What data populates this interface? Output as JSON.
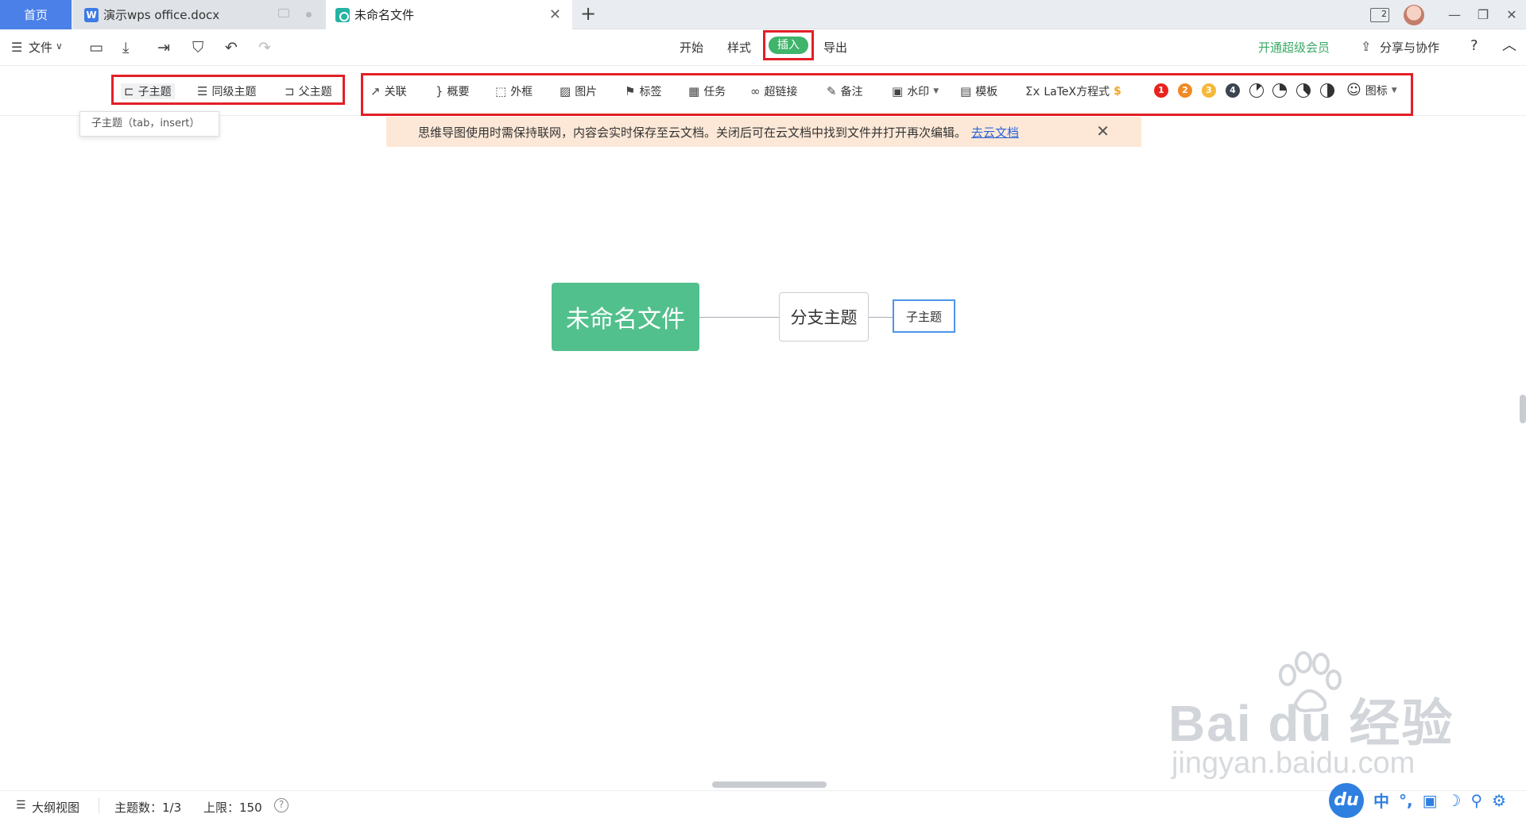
{
  "tabs": {
    "home": "首页",
    "doc": "演示wps office.docx",
    "doc_icon": "W",
    "mind": "未命名文件",
    "add": "+",
    "close": "✕"
  },
  "window": {
    "badge": "2",
    "minimize": "—",
    "restore": "❐",
    "close": "✕"
  },
  "menubar": {
    "file": "文件",
    "tabs": [
      "开始",
      "样式",
      "插入",
      "导出"
    ],
    "active_tab": "插入",
    "vip": "开通超级会员",
    "share": "分享与协作",
    "help": "?",
    "collapse": "︿"
  },
  "toolbar": {
    "group1": [
      "子主题",
      "同级主题",
      "父主题"
    ],
    "group2": [
      "关联",
      "概要",
      "外框",
      "图片",
      "标签",
      "任务",
      "超链接",
      "备注",
      "水印",
      "模板",
      "LaTeX方程式"
    ],
    "priority": [
      "1",
      "2",
      "3",
      "4"
    ],
    "icons_label": "图标",
    "latex_icon": "Σx"
  },
  "tooltip": "子主题（tab，insert）",
  "notice": {
    "text": "思维导图使用时需保持联网，内容会实时保存至云文档。关闭后可在云文档中找到文件并打开再次编辑。",
    "link": "去云文档"
  },
  "mindmap": {
    "root": "未命名文件",
    "branch": "分支主题",
    "child": "子主题"
  },
  "statusbar": {
    "outline": "大纲视图",
    "topic_count": "主题数：1/3",
    "limit": "上限：150",
    "help": "?"
  },
  "watermark": {
    "brand": "Bai du 经验",
    "url": "jingyan.baidu.com"
  },
  "ime": {
    "logo": "du",
    "items": [
      "中",
      "°,",
      "▣",
      "☽",
      "⚲",
      "⚙"
    ]
  },
  "colors": {
    "accent_blue": "#4a80e8",
    "accent_green": "#3fb46a",
    "root_node": "#52c08c",
    "highlight_red": "#e21f26",
    "priority": [
      "#e8221c",
      "#f08a24",
      "#f5b83a",
      "#3c4452"
    ]
  }
}
